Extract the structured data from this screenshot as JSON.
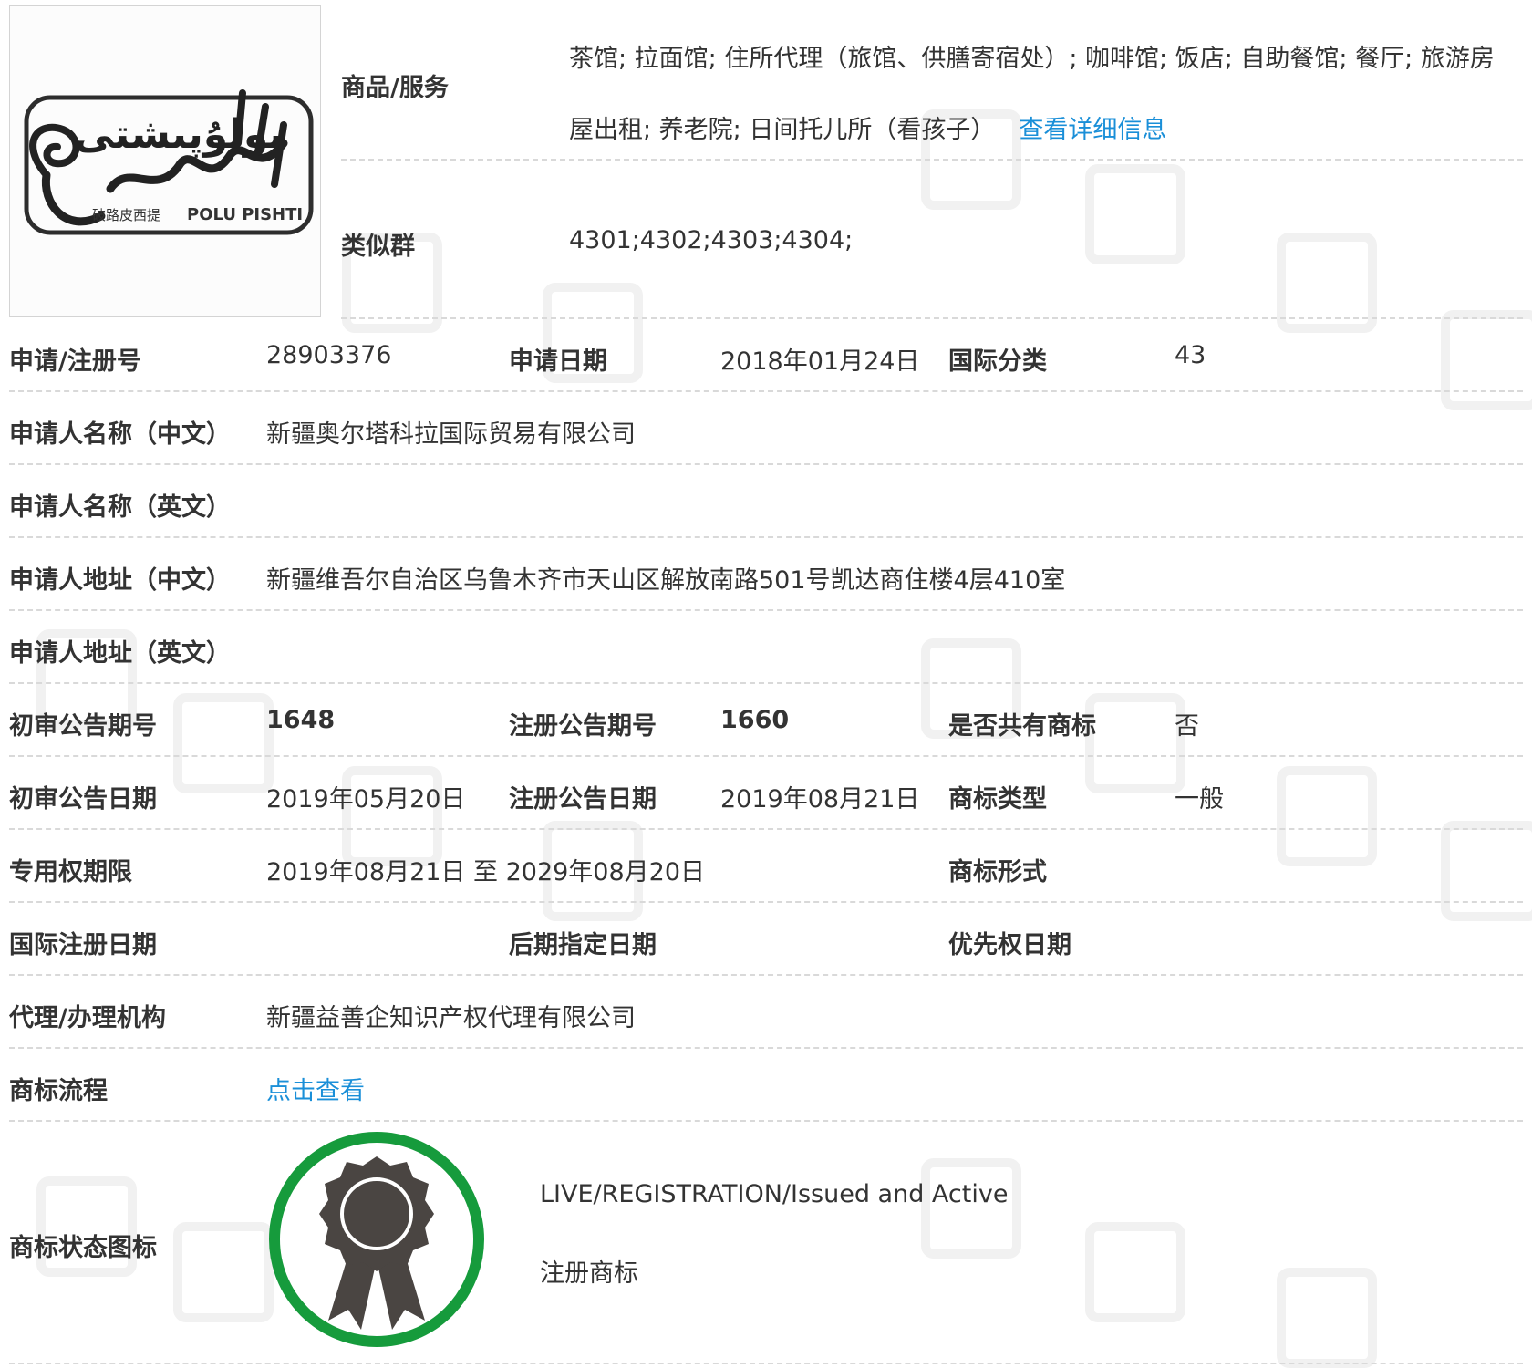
{
  "logo": {
    "latin_text": "POLU PISHTI",
    "chinese_text": "破路皮西提",
    "script_text": "پولۇپىشتى"
  },
  "goods_services": {
    "label": "商品/服务",
    "text": "茶馆; 拉面馆; 住所代理（旅馆、供膳寄宿处）; 咖啡馆; 饭店; 自助餐馆; 餐厅; 旅游房屋出租; 养老院; 日间托儿所（看孩子）",
    "details_link": "查看详细信息"
  },
  "similar_group": {
    "label": "类似群",
    "value": "4301;4302;4303;4304;"
  },
  "fields": {
    "reg_no": {
      "label": "申请/注册号",
      "value": "28903376"
    },
    "app_date": {
      "label": "申请日期",
      "value": "2018年01月24日"
    },
    "intl_class": {
      "label": "国际分类",
      "value": "43"
    },
    "applicant_cn": {
      "label": "申请人名称（中文）",
      "value": "新疆奥尔塔科拉国际贸易有限公司"
    },
    "applicant_en": {
      "label": "申请人名称（英文）",
      "value": ""
    },
    "address_cn": {
      "label": "申请人地址（中文）",
      "value": "新疆维吾尔自治区乌鲁木齐市天山区解放南路501号凯达商住楼4层410室"
    },
    "address_en": {
      "label": "申请人地址（英文）",
      "value": ""
    },
    "prelim_no": {
      "label": "初审公告期号",
      "value": "1648"
    },
    "reg_pub_no": {
      "label": "注册公告期号",
      "value": "1660"
    },
    "shared": {
      "label": "是否共有商标",
      "value": "否"
    },
    "prelim_date": {
      "label": "初审公告日期",
      "value": "2019年05月20日"
    },
    "reg_pub_date": {
      "label": "注册公告日期",
      "value": "2019年08月21日"
    },
    "tm_type": {
      "label": "商标类型",
      "value": "一般"
    },
    "exclusive": {
      "label": "专用权期限",
      "value": "2019年08月21日 至 2029年08月20日"
    },
    "tm_form": {
      "label": "商标形式",
      "value": ""
    },
    "intl_reg_date": {
      "label": "国际注册日期",
      "value": ""
    },
    "later_date": {
      "label": "后期指定日期",
      "value": ""
    },
    "priority_date": {
      "label": "优先权日期",
      "value": ""
    },
    "agency": {
      "label": "代理/办理机构",
      "value": "新疆益善企知识产权代理有限公司"
    },
    "process": {
      "label": "商标流程",
      "link": "点击查看"
    }
  },
  "status": {
    "label": "商标状态图标",
    "en": "LIVE/REGISTRATION/Issued and Active",
    "cn": "注册商标",
    "icon": "award-ribbon-icon",
    "ring_color": "#169b3c",
    "medal_color": "#4a4542"
  },
  "colors": {
    "link": "#1a8fd8",
    "text": "#333333",
    "separator": "#d9d9d9"
  }
}
